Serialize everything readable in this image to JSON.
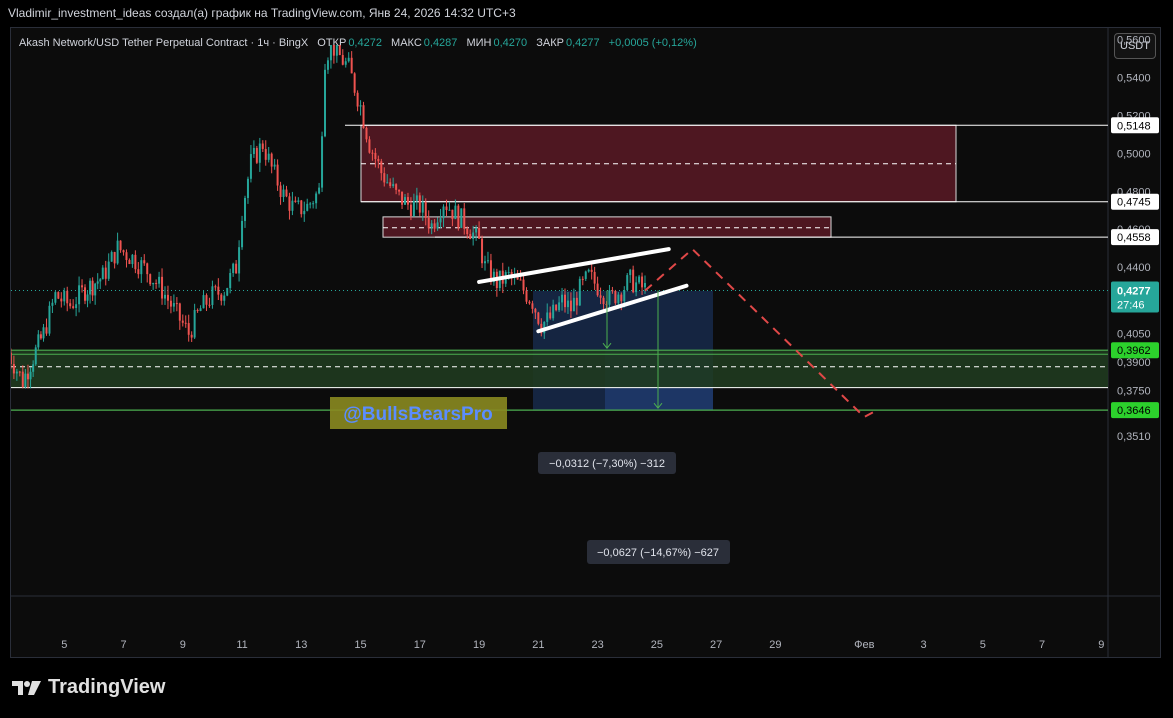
{
  "header": {
    "title": "Vladimir_investment_ideas создал(а) график на TradingView.com, Янв 24, 2026 14:32 UTC+3"
  },
  "symbol": {
    "name": "Akash Network/USD Tether Perpetual Contract · 1ч · BingX",
    "open_label": "ОТКР",
    "open": "0,4272",
    "high_label": "МАКС",
    "high": "0,4287",
    "low_label": "МИН",
    "low": "0,4270",
    "close_label": "ЗАКР",
    "close": "0,4277",
    "change": "+0,0005 (+0,12%)"
  },
  "currency_button": "USDT",
  "watermark": "@BullsBearsPro",
  "brand": "TradingView",
  "colors": {
    "background": "#000000",
    "up": "#26a69a",
    "down": "#ef5350",
    "resistance_zone": "#5a1a25",
    "support_zone": "#1f3a1f",
    "support_line": "#4caf50",
    "projection": "#1e3a6e",
    "watermark_bg": "#8a8a20",
    "watermark_text": "#5b8dff"
  },
  "chart_data": {
    "type": "candlestick",
    "timeframe": "1h",
    "y_axis": {
      "min": 0.34,
      "max": 0.568,
      "ticks": [
        "0,5600",
        "0,5400",
        "0,5200",
        "0,5000",
        "0,4800",
        "0,4600",
        "0,4400",
        "0,4050",
        "0,3900",
        "0,3750",
        "0,3510"
      ],
      "tick_values": [
        0.56,
        0.54,
        0.52,
        0.5,
        0.48,
        0.46,
        0.44,
        0.405,
        0.39,
        0.375,
        0.351
      ]
    },
    "x_axis": {
      "labels": [
        "5",
        "7",
        "9",
        "11",
        "13",
        "15",
        "17",
        "19",
        "21",
        "23",
        "25",
        "27",
        "29",
        "Фев",
        "3",
        "5",
        "7",
        "9"
      ],
      "days": [
        5,
        7,
        9,
        11,
        13,
        15,
        17,
        19,
        21,
        23,
        25,
        27,
        29,
        32,
        34,
        36,
        38,
        40
      ]
    },
    "price_path": [
      [
        3.1,
        0.395
      ],
      [
        3.6,
        0.38
      ],
      [
        4.3,
        0.405
      ],
      [
        4.7,
        0.425
      ],
      [
        5.2,
        0.42
      ],
      [
        5.7,
        0.428
      ],
      [
        6.3,
        0.435
      ],
      [
        6.8,
        0.45
      ],
      [
        7.3,
        0.445
      ],
      [
        7.8,
        0.438
      ],
      [
        8.3,
        0.428
      ],
      [
        8.8,
        0.415
      ],
      [
        9.2,
        0.405
      ],
      [
        9.6,
        0.418
      ],
      [
        10.0,
        0.425
      ],
      [
        10.4,
        0.428
      ],
      [
        10.8,
        0.44
      ],
      [
        11.0,
        0.47
      ],
      [
        11.3,
        0.495
      ],
      [
        11.7,
        0.505
      ],
      [
        12.0,
        0.492
      ],
      [
        12.4,
        0.478
      ],
      [
        12.8,
        0.47
      ],
      [
        13.2,
        0.472
      ],
      [
        13.6,
        0.48
      ],
      [
        13.8,
        0.55
      ],
      [
        14.0,
        0.558
      ],
      [
        14.2,
        0.553
      ],
      [
        14.6,
        0.545
      ],
      [
        15.0,
        0.525
      ],
      [
        15.3,
        0.505
      ],
      [
        15.7,
        0.49
      ],
      [
        16.2,
        0.478
      ],
      [
        16.6,
        0.473
      ],
      [
        17.0,
        0.472
      ],
      [
        17.4,
        0.462
      ],
      [
        17.8,
        0.475
      ],
      [
        18.2,
        0.468
      ],
      [
        18.6,
        0.462
      ],
      [
        19.0,
        0.453
      ],
      [
        19.2,
        0.44
      ],
      [
        19.6,
        0.432
      ],
      [
        20.0,
        0.435
      ],
      [
        20.4,
        0.43
      ],
      [
        20.8,
        0.422
      ],
      [
        21.1,
        0.41
      ],
      [
        21.4,
        0.413
      ],
      [
        21.8,
        0.422
      ],
      [
        22.1,
        0.418
      ],
      [
        22.4,
        0.428
      ],
      [
        22.7,
        0.435
      ],
      [
        23.0,
        0.43
      ],
      [
        23.4,
        0.423
      ],
      [
        23.8,
        0.428
      ],
      [
        24.1,
        0.433
      ],
      [
        24.4,
        0.43
      ],
      [
        24.7,
        0.4277
      ]
    ],
    "annotations": {
      "resistance_zone_upper": {
        "top": 0.5148,
        "bottom": 0.4745,
        "mid": 0.4945
      },
      "resistance_zone_lower": {
        "top": 0.4665,
        "bottom": 0.4558,
        "mid": 0.4608
      },
      "support_zone": {
        "top": 0.3962,
        "bottom": 0.3765,
        "mid": 0.3875
      },
      "support_line": 0.3646,
      "current_price": 0.4277,
      "countdown": "27:46",
      "price_labels": [
        "0,5148",
        "0,4745",
        "0,4558",
        "0,4277",
        "0,3962",
        "0,3646"
      ],
      "channel_upper": [
        [
          19.0,
          0.4322
        ],
        [
          25.4,
          0.4495
        ]
      ],
      "channel_lower": [
        [
          21.0,
          0.4062
        ],
        [
          26.0,
          0.4302
        ]
      ],
      "forecast_path": [
        [
          24.6,
          0.4276
        ],
        [
          26.2,
          0.4495
        ],
        [
          32.0,
          0.361
        ],
        [
          32.3,
          0.3635
        ]
      ],
      "measure_short": {
        "from_price": 0.4277,
        "to_price": 0.3962,
        "label": "−0,0312 (−7,30%) −312"
      },
      "measure_long": {
        "from_price": 0.4277,
        "to_price": 0.3646,
        "label": "−0,0627 (−14,67%) −627"
      }
    }
  }
}
